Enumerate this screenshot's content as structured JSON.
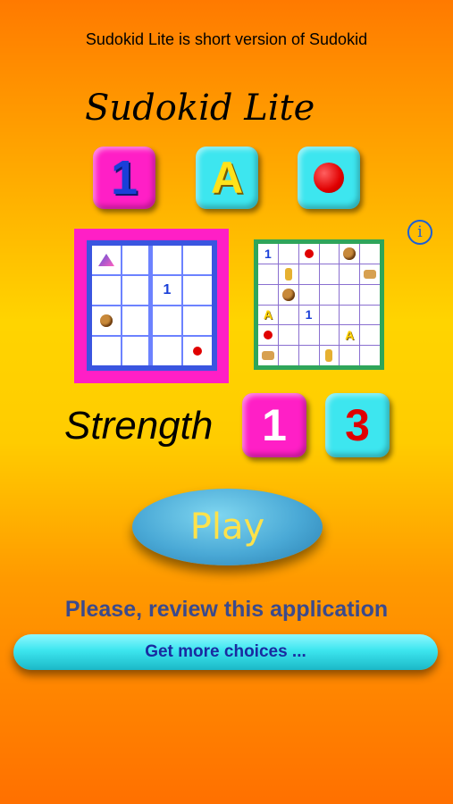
{
  "header": {
    "subtitle": "Sudokid Lite is short version of Sudokid",
    "title": "Sudokid Lite"
  },
  "modes": [
    {
      "label": "1",
      "color": "#ff1fc6"
    },
    {
      "label": "A",
      "color": "#3de6ef"
    },
    {
      "label": "",
      "icon": "red-dot-icon",
      "color": "#3de6ef"
    }
  ],
  "info": {
    "label": "i"
  },
  "board_small": {
    "cells": [
      [
        "hat",
        "",
        "",
        ""
      ],
      [
        "",
        "",
        "1",
        ""
      ],
      [
        "bear",
        "",
        "",
        ""
      ],
      [
        "",
        "",
        "",
        "dot"
      ]
    ]
  },
  "board_large": {
    "cells": [
      [
        "1",
        "",
        "dot",
        "",
        "bear",
        ""
      ],
      [
        "",
        "giraffe",
        "",
        "",
        "",
        "cat"
      ],
      [
        "",
        "bear",
        "",
        "",
        "",
        ""
      ],
      [
        "A",
        "",
        "1",
        "",
        "",
        ""
      ],
      [
        "dot",
        "",
        "",
        "",
        "A",
        ""
      ],
      [
        "cat",
        "",
        "",
        "giraffe",
        "",
        ""
      ]
    ]
  },
  "strength": {
    "label": "Strength",
    "options": [
      {
        "value": "1",
        "color": "#ff1fc6"
      },
      {
        "value": "3",
        "color": "#3de6ef"
      }
    ]
  },
  "play": {
    "label": "Play"
  },
  "review": {
    "label": "Please, review this application"
  },
  "more": {
    "label": "Get more choices ..."
  },
  "colors": {
    "accent_pink": "#ff1fc6",
    "accent_cyan": "#3de6ef",
    "play_text": "#ffe24a"
  }
}
